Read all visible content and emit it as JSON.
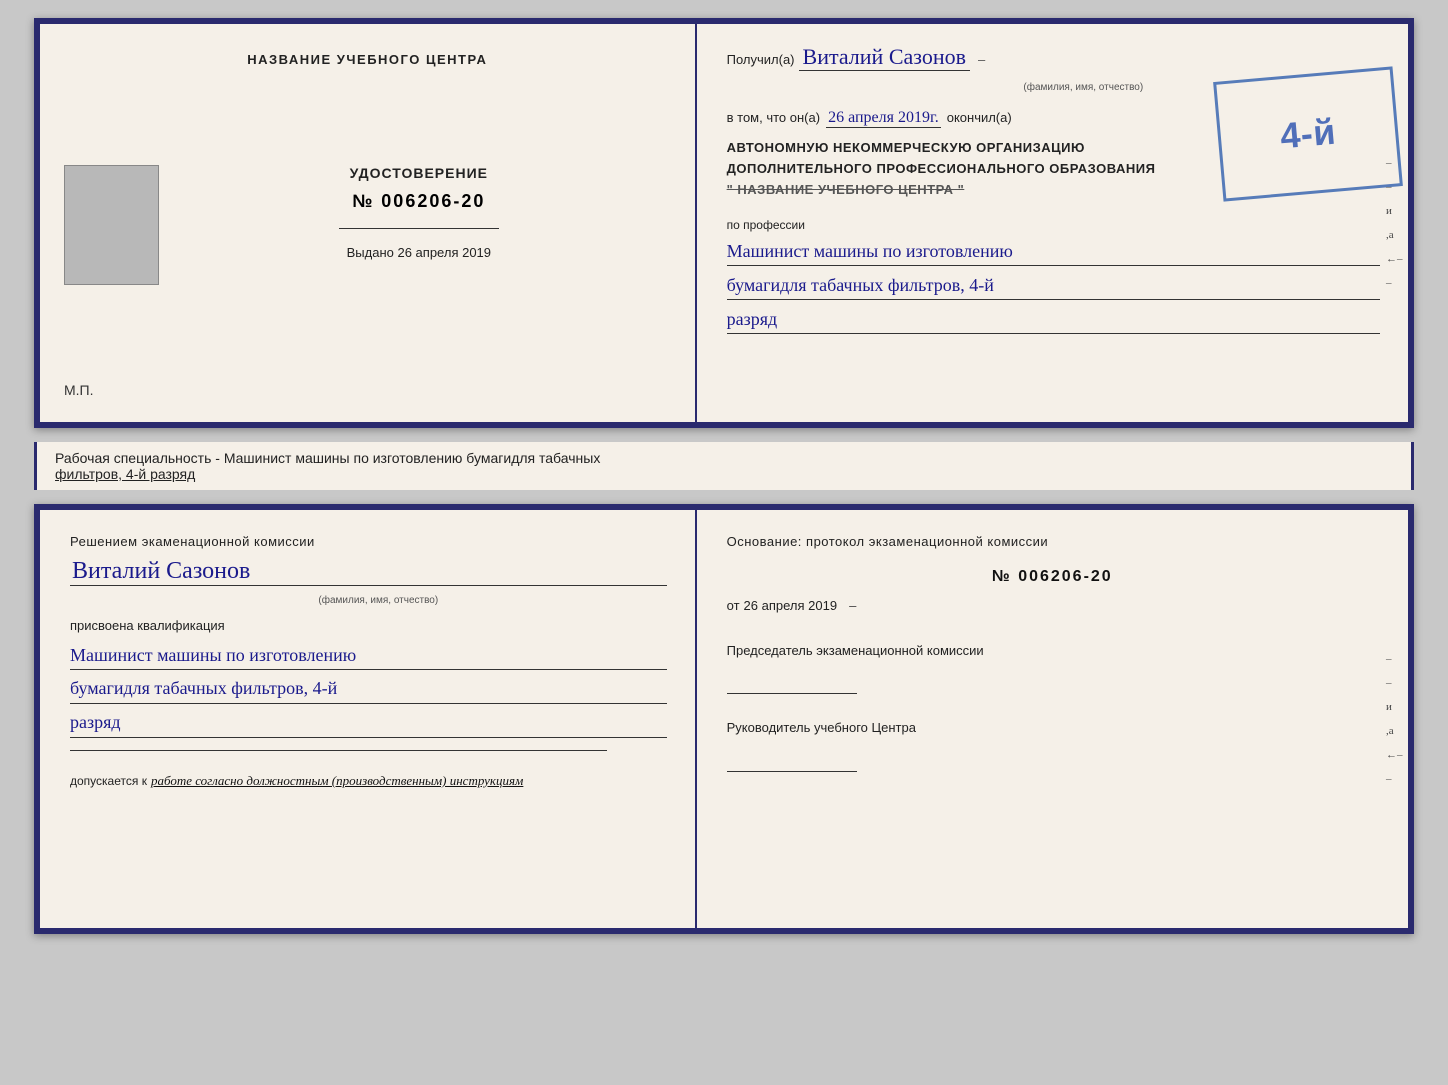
{
  "topCert": {
    "left": {
      "headerLabel": "НАЗВАНИЕ УЧЕБНОГО ЦЕНТРА",
      "udostTitle": "УДОСТОВЕРЕНИЕ",
      "udostNumber": "№ 006206-20",
      "vydanoLabel": "Выдано",
      "vydanoDate": "26 апреля 2019",
      "mpLabel": "М.П."
    },
    "right": {
      "poluchilPrefix": "Получил(а)",
      "recipientName": "Виталий Сазонов",
      "fioLabel": "(фамилия, имя, отчество)",
      "vtomChtoOn": "в том, что он(а)",
      "date": "26 апреля 2019г.",
      "okonchilSuffix": "окончил(а)",
      "stampNum": "4-й",
      "orgLine1": "АВТОНОМНУЮ НЕКОММЕРЧЕСКУЮ ОРГАНИЗАЦИЮ",
      "orgLine2": "ДОПОЛНИТЕЛЬНОГО ПРОФЕССИОНАЛЬНОГО ОБРАЗОВАНИЯ",
      "orgLine3": "\" НАЗВАНИЕ УЧЕБНОГО ЦЕНТРА \"",
      "professionLabel": "по профессии",
      "professionLine1": "Машинист машины по изготовлению",
      "professionLine2": "бумагидля табачных фильтров, 4-й",
      "professionLine3": "разряд"
    }
  },
  "middleBar": {
    "text": "Рабочая специальность - Машинист машины по изготовлению бумагидля табачных",
    "textUnderlined": "фильтров, 4-й разряд"
  },
  "bottomCert": {
    "left": {
      "decisionText": "Решением экаменационной комиссии",
      "recipientName": "Виталий Сазонов",
      "fioLabel": "(фамилия, имя, отчество)",
      "prisvoyenaText": "присвоена квалификация",
      "qualLine1": "Машинист машины по изготовлению",
      "qualLine2": "бумагидля табачных фильтров, 4-й",
      "qualLine3": "разряд",
      "dopuskaetsyaPrefix": "допускается к",
      "dopuskaetsyaText": "работе согласно должностным (производственным) инструкциям"
    },
    "right": {
      "osnovText": "Основание: протокол экзаменационной комиссии",
      "protocolNumber": "№ 006206-20",
      "otLabel": "от",
      "otDate": "26 апреля 2019",
      "chairmanLabel": "Председатель экзаменационной комиссии",
      "rukovoditelLabel": "Руководитель учебного Центра"
    },
    "rightSide": {
      "chars": [
        "И",
        "а",
        "←"
      ]
    }
  }
}
